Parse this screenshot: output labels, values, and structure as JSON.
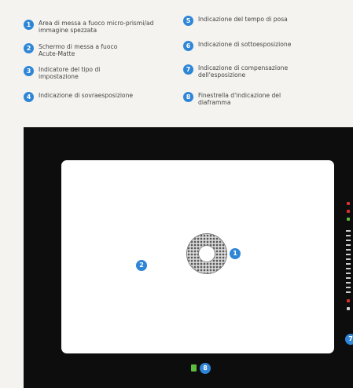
{
  "legend": [
    {
      "num": "1",
      "text": "Area di messa a fuoco micro-prismi/ad immagine spezzata"
    },
    {
      "num": "2",
      "text": "Schermo di messa a fuoco Acute-Matte"
    },
    {
      "num": "3",
      "text": "Indicatore del tipo di impostazione"
    },
    {
      "num": "4",
      "text": "Indicazione di sovraesposizione"
    },
    {
      "num": "5",
      "text": "Indicazione del tempo di posa"
    },
    {
      "num": "6",
      "text": "Indicazione di sottoesposizione"
    },
    {
      "num": "7",
      "text": "Indicazione di compensazione dell'esposizione"
    },
    {
      "num": "8",
      "text": "Finestrella d'indicazione del diaframma"
    }
  ],
  "markers": {
    "center": "1",
    "screen": "2",
    "side": "7",
    "bottom": "8"
  },
  "colors": {
    "accent": "#2f86d6",
    "viewfinder_bg": "#0d0d0d",
    "indicator_red": "#d8322f",
    "indicator_green": "#5dbb3e"
  }
}
